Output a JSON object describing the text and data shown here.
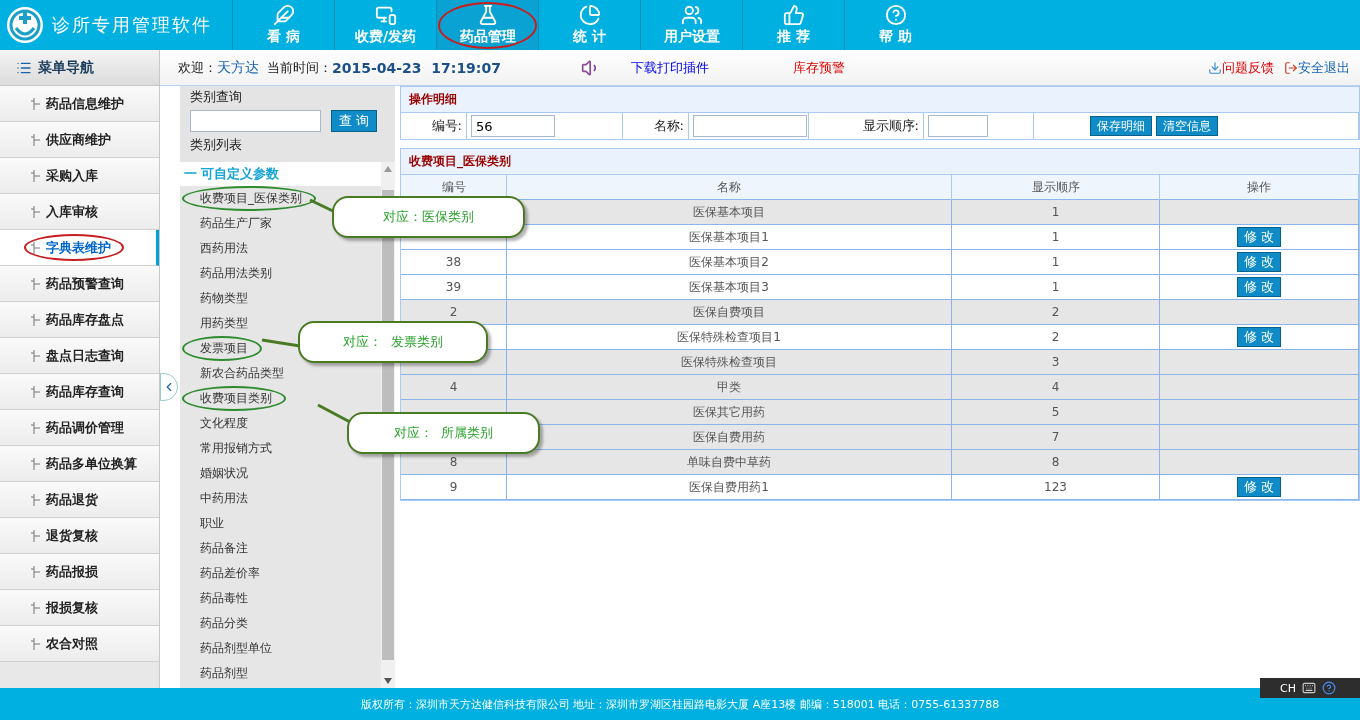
{
  "app": {
    "title": "诊所专用管理软件"
  },
  "nav": [
    {
      "label": "看 病",
      "selected": false,
      "circled": false
    },
    {
      "label": "收费/发药",
      "selected": false,
      "circled": false
    },
    {
      "label": "药品管理",
      "selected": true,
      "circled": true
    },
    {
      "label": "统 计",
      "selected": false,
      "circled": false
    },
    {
      "label": "用户设置",
      "selected": false,
      "circled": false
    },
    {
      "label": "推 荐",
      "selected": false,
      "circled": false
    },
    {
      "label": "帮 助",
      "selected": false,
      "circled": false
    }
  ],
  "sidebar": {
    "title": "菜单导航",
    "items": [
      {
        "label": "药品信息维护",
        "selected": false,
        "circled": false
      },
      {
        "label": "供应商维护",
        "selected": false,
        "circled": false
      },
      {
        "label": "采购入库",
        "selected": false,
        "circled": false
      },
      {
        "label": "入库审核",
        "selected": false,
        "circled": false
      },
      {
        "label": "字典表维护",
        "selected": true,
        "circled": true
      },
      {
        "label": "药品预警查询",
        "selected": false,
        "circled": false
      },
      {
        "label": "药品库存盘点",
        "selected": false,
        "circled": false
      },
      {
        "label": "盘点日志查询",
        "selected": false,
        "circled": false
      },
      {
        "label": "药品库存查询",
        "selected": false,
        "circled": false
      },
      {
        "label": "药品调价管理",
        "selected": false,
        "circled": false
      },
      {
        "label": "药品多单位换算",
        "selected": false,
        "circled": false
      },
      {
        "label": "药品退货",
        "selected": false,
        "circled": false
      },
      {
        "label": "退货复核",
        "selected": false,
        "circled": false
      },
      {
        "label": "药品报损",
        "selected": false,
        "circled": false
      },
      {
        "label": "报损复核",
        "selected": false,
        "circled": false
      },
      {
        "label": "农合对照",
        "selected": false,
        "circled": false
      }
    ]
  },
  "info_bar": {
    "welcome_label": "欢迎：",
    "user": "天方达",
    "time_label": "当前时间：",
    "datetime": "2015-04-23  17:19:07",
    "plugin_link": "下载打印插件",
    "stock_alert": "库存预警",
    "feedback": "问题反馈",
    "logout": "安全退出"
  },
  "category_panel": {
    "search_label": "类别查询",
    "search_button": "查 询",
    "list_title": "类别列表",
    "group": {
      "toggle": "一",
      "label": "可自定义参数"
    },
    "items": [
      {
        "label": "收费项目_医保类别",
        "circled": true
      },
      {
        "label": "药品生产厂家",
        "circled": false
      },
      {
        "label": "西药用法",
        "circled": false
      },
      {
        "label": "药品用法类别",
        "circled": false
      },
      {
        "label": "药物类型",
        "circled": false
      },
      {
        "label": "用药类型",
        "circled": false
      },
      {
        "label": "发票项目",
        "circled": true
      },
      {
        "label": "新农合药品类型",
        "circled": false
      },
      {
        "label": "收费项目类别",
        "circled": true
      },
      {
        "label": "文化程度",
        "circled": false
      },
      {
        "label": "常用报销方式",
        "circled": false
      },
      {
        "label": "婚姻状况",
        "circled": false
      },
      {
        "label": "中药用法",
        "circled": false
      },
      {
        "label": "职业",
        "circled": false
      },
      {
        "label": "药品备注",
        "circled": false
      },
      {
        "label": "药品差价率",
        "circled": false
      },
      {
        "label": "药品毒性",
        "circled": false
      },
      {
        "label": "药品分类",
        "circled": false
      },
      {
        "label": "药品剂型单位",
        "circled": false
      },
      {
        "label": "药品剂型",
        "circled": false
      }
    ]
  },
  "detail_form": {
    "title": "操作明细",
    "id_label": "编号:",
    "id_value": "56",
    "name_label": "名称:",
    "order_label": "显示顺序:",
    "save_button": "保存明细",
    "clear_button": "清空信息"
  },
  "table": {
    "title": "收费项目_医保类别",
    "columns": [
      "编号",
      "名称",
      "显示顺序",
      "操作"
    ],
    "rows": [
      {
        "name": "医保基本项目",
        "order": "1",
        "shaded": true
      },
      {
        "name": "医保基本项目1",
        "order": "1",
        "shaded": false,
        "action": "修 改"
      },
      {
        "id": "38",
        "name": "医保基本项目2",
        "order": "1",
        "shaded": false,
        "action": "修 改"
      },
      {
        "id": "39",
        "name": "医保基本项目3",
        "order": "1",
        "shaded": false,
        "action": "修 改"
      },
      {
        "id": "2",
        "name": "医保自费项目",
        "order": "2",
        "shaded": true
      },
      {
        "name": "医保特殊检查项目1",
        "order": "2",
        "shaded": false,
        "action": "修 改"
      },
      {
        "name": "医保特殊检查项目",
        "order": "3",
        "shaded": true
      },
      {
        "id": "4",
        "name": "甲类",
        "order": "4",
        "shaded": true
      },
      {
        "name": "医保其它用药",
        "order": "5",
        "shaded": true
      },
      {
        "name": "医保自费用药",
        "order": "7",
        "shaded": true
      },
      {
        "id": "8",
        "name": "单味自费中草药",
        "order": "8",
        "shaded": true
      },
      {
        "id": "9",
        "name": "医保自费用药1",
        "order": "123",
        "shaded": false,
        "action": "修 改"
      }
    ]
  },
  "callouts": [
    {
      "text": "对应：医保类别"
    },
    {
      "text": "对应：  发票类别"
    },
    {
      "text": "对应：  所属类别"
    }
  ],
  "footer": "版权所有：深圳市天方达健信科技有限公司 地址：深圳市罗湖区桂园路电影大厦 A座13楼 邮编：518001 电话：0755-61337788",
  "ime_bar": {
    "label": "CH"
  }
}
